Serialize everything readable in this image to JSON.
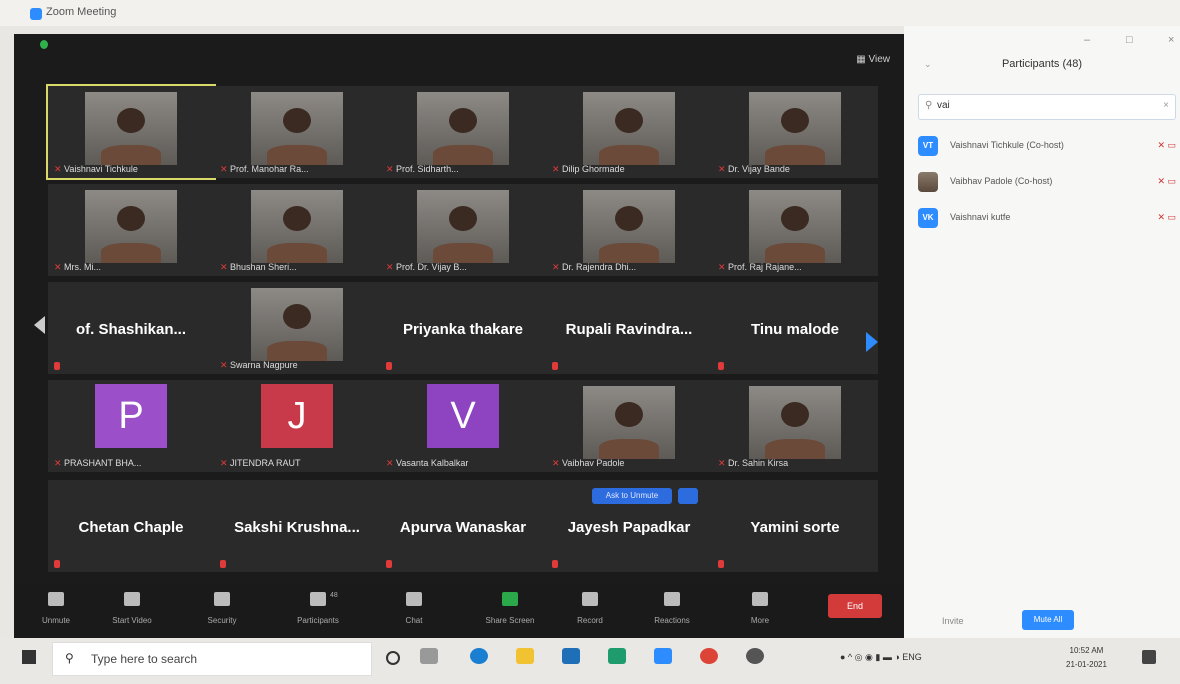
{
  "window": {
    "title": "Zoom Meeting",
    "controls": [
      "–",
      "□",
      "×"
    ]
  },
  "meeting": {
    "view_label": "View",
    "gallery": [
      {
        "name": "Vaishnavi Tichkule",
        "type": "video",
        "selected": true
      },
      {
        "name": "Prof. Manohar Ra...",
        "type": "video"
      },
      {
        "name": "Prof. Sidharth...",
        "type": "video"
      },
      {
        "name": "Dilip Ghormade",
        "type": "video"
      },
      {
        "name": "Dr. Vijay Bande",
        "type": "video"
      },
      {
        "name": "Mrs. Mi...",
        "type": "video"
      },
      {
        "name": "Bhushan Sheri...",
        "type": "video"
      },
      {
        "name": "Prof. Dr. Vijay B...",
        "type": "video"
      },
      {
        "name": "Dr. Rajendra Dhi...",
        "type": "video"
      },
      {
        "name": "Prof. Raj Rajane...",
        "type": "video"
      },
      {
        "name": "of. Shashikan...",
        "type": "name"
      },
      {
        "name": "Swarna Nagpure",
        "type": "video"
      },
      {
        "name": "Priyanka thakare",
        "type": "name"
      },
      {
        "name": "Rupali Ravindra...",
        "type": "name"
      },
      {
        "name": "Tinu malode",
        "type": "name"
      },
      {
        "name": "PRASHANT BHA...",
        "type": "avatar",
        "letter": "P",
        "color": "#9b4fc9"
      },
      {
        "name": "JITENDRA RAUT",
        "type": "avatar",
        "letter": "J",
        "color": "#c8394a"
      },
      {
        "name": "Vasanta Kalbalkar",
        "type": "avatar",
        "letter": "V",
        "color": "#8e44c0"
      },
      {
        "name": "Vaibhav Padole",
        "type": "video"
      },
      {
        "name": "Dr. Sahin Kirsa",
        "type": "video"
      },
      {
        "name": "Chetan Chaple",
        "type": "name"
      },
      {
        "name": "Sakshi Krushna...",
        "type": "name"
      },
      {
        "name": "Apurva Wanaskar",
        "type": "name"
      },
      {
        "name": "Jayesh Papadkar",
        "type": "name"
      },
      {
        "name": "Yamini sorte",
        "type": "name"
      }
    ],
    "spotlight_pill": "Ask to Unmute",
    "toolbar": [
      {
        "label": "Unmute",
        "icon": "mic-icon"
      },
      {
        "label": "Start Video",
        "icon": "video-icon"
      },
      {
        "label": "Security",
        "icon": "shield-icon"
      },
      {
        "label": "Participants",
        "icon": "participants-icon",
        "count": "48"
      },
      {
        "label": "Chat",
        "icon": "chat-icon"
      },
      {
        "label": "Share Screen",
        "icon": "share-screen-icon"
      },
      {
        "label": "Record",
        "icon": "record-icon"
      },
      {
        "label": "Reactions",
        "icon": "reactions-icon"
      },
      {
        "label": "More",
        "icon": "more-icon"
      }
    ],
    "end_label": "End"
  },
  "participants_panel": {
    "title": "Participants (48)",
    "search_value": "vai",
    "rows": [
      {
        "initials": "VT",
        "name": "Vaishnavi Tichkule (Co-host)"
      },
      {
        "initials": "",
        "name": "Vaibhav Padole (Co-host)"
      },
      {
        "initials": "VK",
        "name": "Vaishnavi kutfe"
      }
    ],
    "invite_label": "Invite",
    "mute_all_label": "Mute All"
  },
  "taskbar": {
    "search_placeholder": "Type here to search",
    "tray_lang": "ENG",
    "time": "10:52 AM",
    "date": "21-01-2021"
  }
}
